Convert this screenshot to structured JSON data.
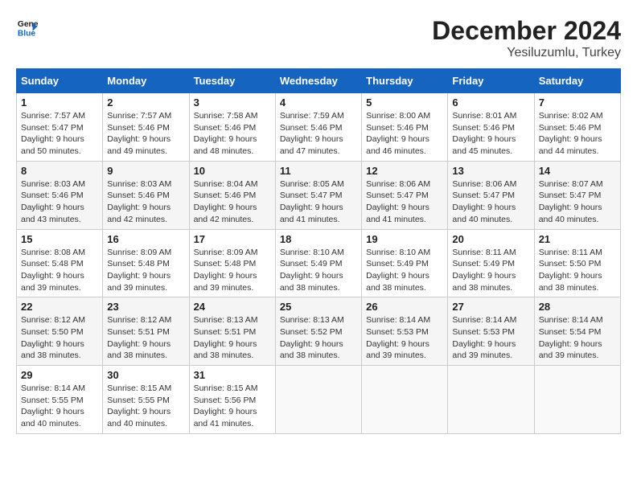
{
  "header": {
    "logo_line1": "General",
    "logo_line2": "Blue",
    "month_title": "December 2024",
    "location": "Yesiluzumlu, Turkey"
  },
  "days_of_week": [
    "Sunday",
    "Monday",
    "Tuesday",
    "Wednesday",
    "Thursday",
    "Friday",
    "Saturday"
  ],
  "weeks": [
    [
      {
        "day": "1",
        "sunrise": "7:57 AM",
        "sunset": "5:47 PM",
        "daylight": "9 hours and 50 minutes."
      },
      {
        "day": "2",
        "sunrise": "7:57 AM",
        "sunset": "5:46 PM",
        "daylight": "9 hours and 49 minutes."
      },
      {
        "day": "3",
        "sunrise": "7:58 AM",
        "sunset": "5:46 PM",
        "daylight": "9 hours and 48 minutes."
      },
      {
        "day": "4",
        "sunrise": "7:59 AM",
        "sunset": "5:46 PM",
        "daylight": "9 hours and 47 minutes."
      },
      {
        "day": "5",
        "sunrise": "8:00 AM",
        "sunset": "5:46 PM",
        "daylight": "9 hours and 46 minutes."
      },
      {
        "day": "6",
        "sunrise": "8:01 AM",
        "sunset": "5:46 PM",
        "daylight": "9 hours and 45 minutes."
      },
      {
        "day": "7",
        "sunrise": "8:02 AM",
        "sunset": "5:46 PM",
        "daylight": "9 hours and 44 minutes."
      }
    ],
    [
      {
        "day": "8",
        "sunrise": "8:03 AM",
        "sunset": "5:46 PM",
        "daylight": "9 hours and 43 minutes."
      },
      {
        "day": "9",
        "sunrise": "8:03 AM",
        "sunset": "5:46 PM",
        "daylight": "9 hours and 42 minutes."
      },
      {
        "day": "10",
        "sunrise": "8:04 AM",
        "sunset": "5:46 PM",
        "daylight": "9 hours and 42 minutes."
      },
      {
        "day": "11",
        "sunrise": "8:05 AM",
        "sunset": "5:47 PM",
        "daylight": "9 hours and 41 minutes."
      },
      {
        "day": "12",
        "sunrise": "8:06 AM",
        "sunset": "5:47 PM",
        "daylight": "9 hours and 41 minutes."
      },
      {
        "day": "13",
        "sunrise": "8:06 AM",
        "sunset": "5:47 PM",
        "daylight": "9 hours and 40 minutes."
      },
      {
        "day": "14",
        "sunrise": "8:07 AM",
        "sunset": "5:47 PM",
        "daylight": "9 hours and 40 minutes."
      }
    ],
    [
      {
        "day": "15",
        "sunrise": "8:08 AM",
        "sunset": "5:48 PM",
        "daylight": "9 hours and 39 minutes."
      },
      {
        "day": "16",
        "sunrise": "8:09 AM",
        "sunset": "5:48 PM",
        "daylight": "9 hours and 39 minutes."
      },
      {
        "day": "17",
        "sunrise": "8:09 AM",
        "sunset": "5:48 PM",
        "daylight": "9 hours and 39 minutes."
      },
      {
        "day": "18",
        "sunrise": "8:10 AM",
        "sunset": "5:49 PM",
        "daylight": "9 hours and 38 minutes."
      },
      {
        "day": "19",
        "sunrise": "8:10 AM",
        "sunset": "5:49 PM",
        "daylight": "9 hours and 38 minutes."
      },
      {
        "day": "20",
        "sunrise": "8:11 AM",
        "sunset": "5:49 PM",
        "daylight": "9 hours and 38 minutes."
      },
      {
        "day": "21",
        "sunrise": "8:11 AM",
        "sunset": "5:50 PM",
        "daylight": "9 hours and 38 minutes."
      }
    ],
    [
      {
        "day": "22",
        "sunrise": "8:12 AM",
        "sunset": "5:50 PM",
        "daylight": "9 hours and 38 minutes."
      },
      {
        "day": "23",
        "sunrise": "8:12 AM",
        "sunset": "5:51 PM",
        "daylight": "9 hours and 38 minutes."
      },
      {
        "day": "24",
        "sunrise": "8:13 AM",
        "sunset": "5:51 PM",
        "daylight": "9 hours and 38 minutes."
      },
      {
        "day": "25",
        "sunrise": "8:13 AM",
        "sunset": "5:52 PM",
        "daylight": "9 hours and 38 minutes."
      },
      {
        "day": "26",
        "sunrise": "8:14 AM",
        "sunset": "5:53 PM",
        "daylight": "9 hours and 39 minutes."
      },
      {
        "day": "27",
        "sunrise": "8:14 AM",
        "sunset": "5:53 PM",
        "daylight": "9 hours and 39 minutes."
      },
      {
        "day": "28",
        "sunrise": "8:14 AM",
        "sunset": "5:54 PM",
        "daylight": "9 hours and 39 minutes."
      }
    ],
    [
      {
        "day": "29",
        "sunrise": "8:14 AM",
        "sunset": "5:55 PM",
        "daylight": "9 hours and 40 minutes."
      },
      {
        "day": "30",
        "sunrise": "8:15 AM",
        "sunset": "5:55 PM",
        "daylight": "9 hours and 40 minutes."
      },
      {
        "day": "31",
        "sunrise": "8:15 AM",
        "sunset": "5:56 PM",
        "daylight": "9 hours and 41 minutes."
      },
      null,
      null,
      null,
      null
    ]
  ],
  "labels": {
    "sunrise_prefix": "Sunrise: ",
    "sunset_prefix": "Sunset: ",
    "daylight_prefix": "Daylight: "
  }
}
